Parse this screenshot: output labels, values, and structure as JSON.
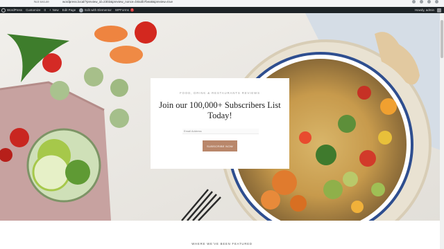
{
  "browser": {
    "security_label": "Not secure",
    "url": "wordpress.local/?preview_id=2302&preview_nonce=b0a3b7bea8&preview=true"
  },
  "admin_bar": {
    "items": [
      "WordPress",
      "Customize",
      "0",
      "New",
      "Edit Page",
      "Edit with Elementor",
      "WPForms"
    ],
    "wpforms_badge": "1",
    "howdy": "Howdy, admin"
  },
  "subscribe": {
    "eyebrow": "FOOD, DRINK & RESTAURANTS REVIEWS",
    "heading": "Join our 100,000+ Subscribers List Today!",
    "email_placeholder": "Email Address",
    "button_label": "SUBSCRIBE NOW"
  },
  "featured": {
    "label": "WHERE WE'VE BEEN FEATURED"
  },
  "colors": {
    "admin_bar_bg": "#1d2327",
    "button_bg": "#b9876b",
    "card_bg": "#ffffff"
  }
}
